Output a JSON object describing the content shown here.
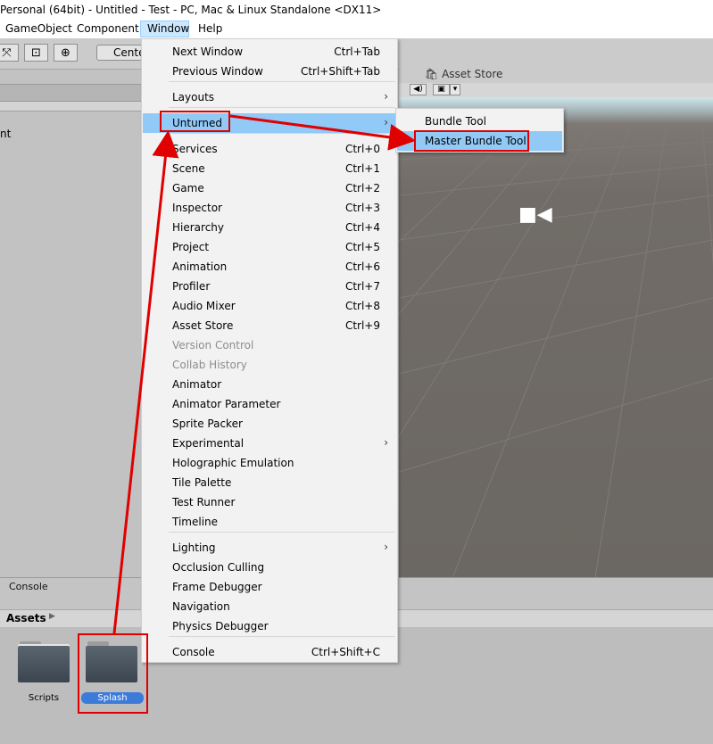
{
  "window_title": "Personal (64bit) - Untitled - Test - PC, Mac & Linux Standalone <DX11>",
  "menubar": {
    "items": [
      "GameObject",
      "Component",
      "Window",
      "Help"
    ]
  },
  "toolbar": {
    "center_label": "Cente"
  },
  "left_panel": {
    "fragment": "nt"
  },
  "scene": {
    "asset_store_tab": "Asset Store"
  },
  "console_tab": "Console",
  "project": {
    "assets_label": "Assets",
    "folders": [
      "Scripts",
      "Splash"
    ]
  },
  "window_menu": [
    {
      "label": "Next Window",
      "shortcut": "Ctrl+Tab"
    },
    {
      "label": "Previous Window",
      "shortcut": "Ctrl+Shift+Tab"
    },
    {
      "label": "Layouts",
      "shortcut": ""
    },
    {
      "label": "Unturned",
      "shortcut": ""
    },
    {
      "label": "Services",
      "shortcut": "Ctrl+0"
    },
    {
      "label": "Scene",
      "shortcut": "Ctrl+1"
    },
    {
      "label": "Game",
      "shortcut": "Ctrl+2"
    },
    {
      "label": "Inspector",
      "shortcut": "Ctrl+3"
    },
    {
      "label": "Hierarchy",
      "shortcut": "Ctrl+4"
    },
    {
      "label": "Project",
      "shortcut": "Ctrl+5"
    },
    {
      "label": "Animation",
      "shortcut": "Ctrl+6"
    },
    {
      "label": "Profiler",
      "shortcut": "Ctrl+7"
    },
    {
      "label": "Audio Mixer",
      "shortcut": "Ctrl+8"
    },
    {
      "label": "Asset Store",
      "shortcut": "Ctrl+9"
    },
    {
      "label": "Version Control",
      "shortcut": ""
    },
    {
      "label": "Collab History",
      "shortcut": ""
    },
    {
      "label": "Animator",
      "shortcut": ""
    },
    {
      "label": "Animator Parameter",
      "shortcut": ""
    },
    {
      "label": "Sprite Packer",
      "shortcut": ""
    },
    {
      "label": "Experimental",
      "shortcut": ""
    },
    {
      "label": "Holographic Emulation",
      "shortcut": ""
    },
    {
      "label": "Tile Palette",
      "shortcut": ""
    },
    {
      "label": "Test Runner",
      "shortcut": ""
    },
    {
      "label": "Timeline",
      "shortcut": ""
    },
    {
      "label": "Lighting",
      "shortcut": ""
    },
    {
      "label": "Occlusion Culling",
      "shortcut": ""
    },
    {
      "label": "Frame Debugger",
      "shortcut": ""
    },
    {
      "label": "Navigation",
      "shortcut": ""
    },
    {
      "label": "Physics Debugger",
      "shortcut": ""
    },
    {
      "label": "Console",
      "shortcut": "Ctrl+Shift+C"
    }
  ],
  "unturned_submenu": [
    {
      "label": "Bundle Tool"
    },
    {
      "label": "Master Bundle Tool"
    }
  ],
  "colors": {
    "menu_highlight": "#91c9f7",
    "annotation_red": "#e00000",
    "selected_asset": "#3d7bd9"
  }
}
